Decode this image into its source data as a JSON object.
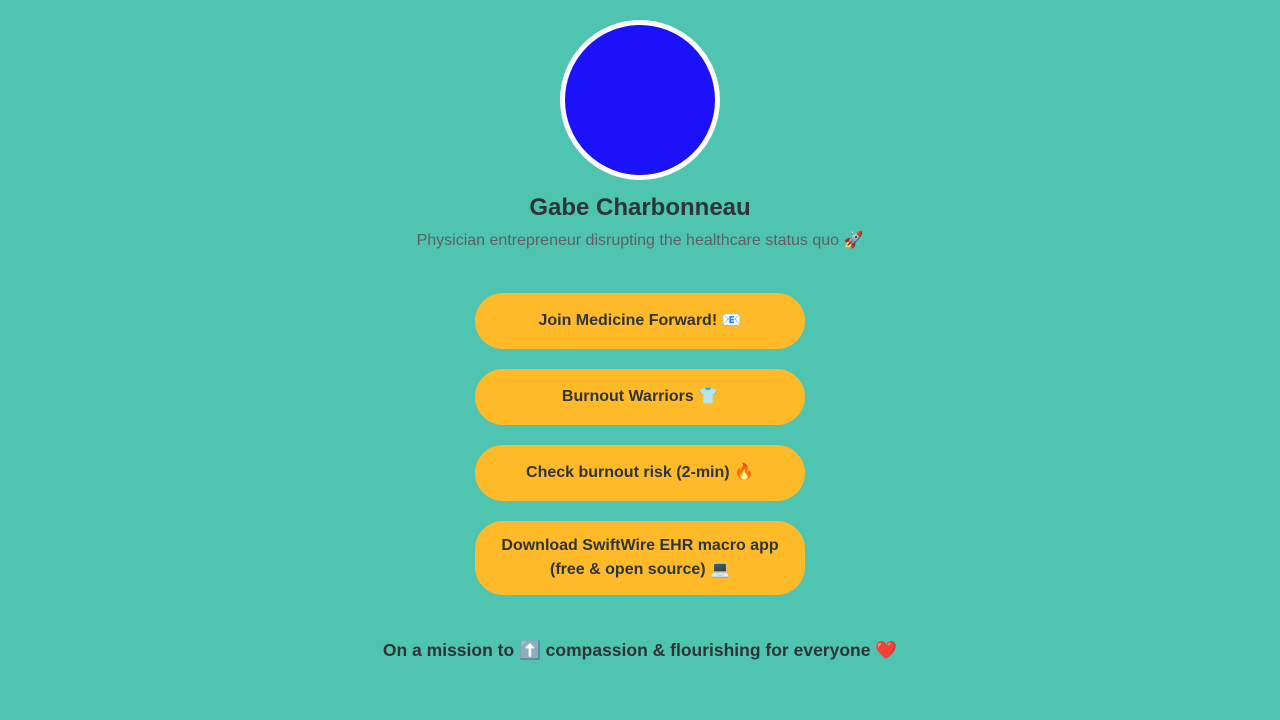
{
  "profile": {
    "name": "Gabe Charbonneau",
    "bio": "Physician entrepreneur disrupting the healthcare status quo 🚀",
    "avatar_color": "#1b12f9"
  },
  "links": [
    {
      "label": "Join Medicine Forward! 📧"
    },
    {
      "label": "Burnout Warriors 👕"
    },
    {
      "label": "Check burnout risk (2-min) 🔥"
    },
    {
      "label": "Download SwiftWire EHR macro app (free & open source) 💻"
    }
  ],
  "footer": {
    "text": "On a mission to ⬆️ compassion & flourishing for everyone ❤️"
  },
  "colors": {
    "background": "#4fc5b1",
    "button": "#ffba2a",
    "text": "#2f3436",
    "bio_text": "#5d5f63"
  }
}
